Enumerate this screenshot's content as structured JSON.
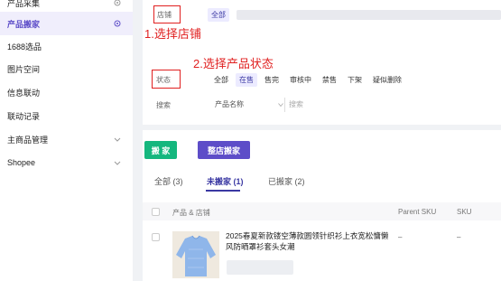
{
  "sidebar": {
    "items": [
      {
        "label": "产品采集"
      },
      {
        "label": "产品搬家"
      },
      {
        "label": "1688选品"
      },
      {
        "label": "图片空间"
      },
      {
        "label": "信息联动"
      },
      {
        "label": "联动记录"
      },
      {
        "label": "主商品管理"
      },
      {
        "label": "Shopee"
      }
    ]
  },
  "filters": {
    "store_label": "店铺",
    "store_all": "全部",
    "annotation_1": "1.选择店铺",
    "annotation_2": "2.选择产品状态",
    "status_label": "状态",
    "status_options": [
      "全部",
      "在售",
      "售完",
      "审核中",
      "禁售",
      "下架",
      "疑似删除"
    ],
    "search_label": "搜索",
    "search_field": "产品名称",
    "search_placeholder": "搜索"
  },
  "actions": {
    "move_button": "搬 家",
    "move_store_button": "整店搬家"
  },
  "tabs": [
    {
      "label": "全部 (3)"
    },
    {
      "label": "未搬家 (1)"
    },
    {
      "label": "已搬家 (2)"
    }
  ],
  "table": {
    "headers": [
      "产品 & 店铺",
      "Parent SKU",
      "SKU"
    ],
    "rows": [
      {
        "title": "2025春夏新款镂空薄款圆领针织衫上衣宽松慵懒风防晒罩衫套头女潮",
        "parent_sku": "–",
        "sku": "–"
      }
    ]
  },
  "colors": {
    "accent": "#5d4dc8",
    "move_button": "#15b77e",
    "annotation": "#e02020"
  }
}
